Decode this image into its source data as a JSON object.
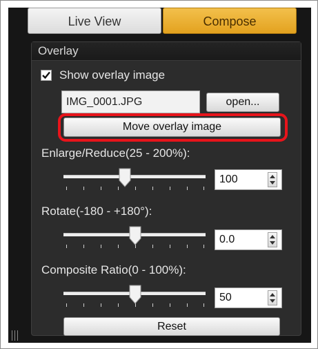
{
  "tabs": {
    "live_view": "Live View",
    "compose": "Compose",
    "active_color": "#e9ac2a"
  },
  "overlay": {
    "title": "Overlay",
    "show_overlay": {
      "label": "Show overlay image",
      "checked": true
    },
    "file_name": "IMG_0001.JPG",
    "open_label": "open...",
    "move_label": "Move overlay image",
    "highlight_color": "#e8141b"
  },
  "enlarge": {
    "label": "Enlarge/Reduce(25 - 200%):",
    "value": "100",
    "min": 25,
    "max": 200
  },
  "rotate": {
    "label": "Rotate(-180 - +180°):",
    "value": "0.0",
    "min": -180,
    "max": 180
  },
  "composite": {
    "label": "Composite Ratio(0 - 100%):",
    "value": "50",
    "min": 0,
    "max": 100
  },
  "reset_label": "Reset"
}
